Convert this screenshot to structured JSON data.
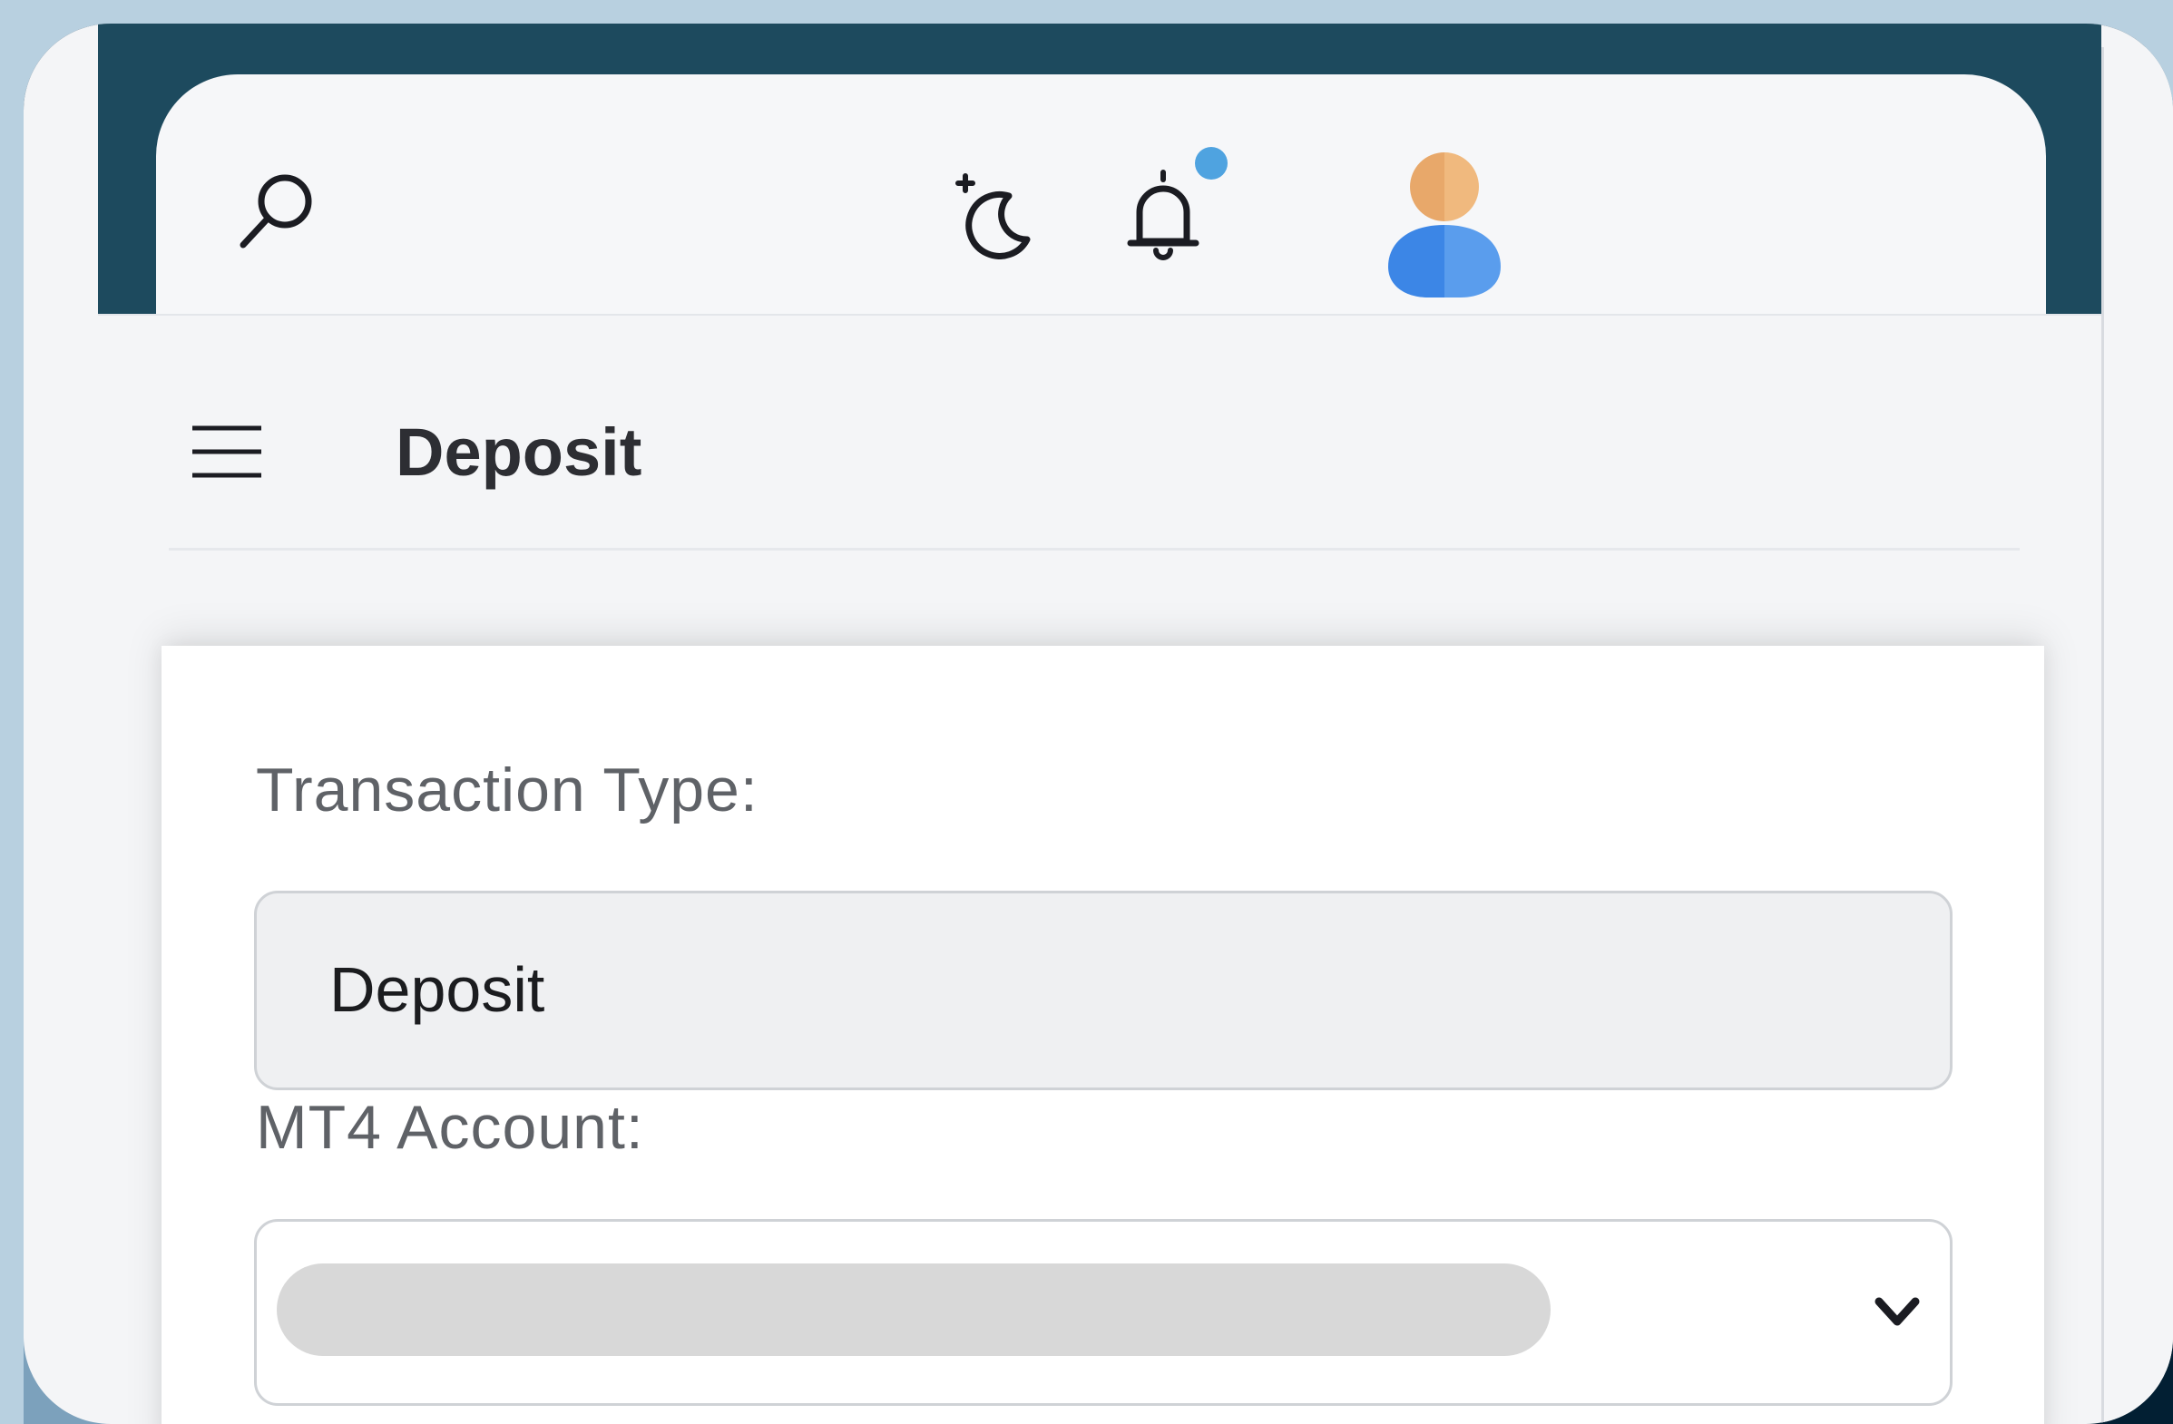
{
  "header": {
    "icons": [
      "search-icon",
      "moon-icon",
      "bell-icon",
      "avatar"
    ],
    "notification_dot_color": "#4fa3e0"
  },
  "subheader": {
    "title": "Deposit"
  },
  "form": {
    "transaction_type_label": "Transaction Type:",
    "transaction_type_value": "Deposit",
    "account_label": "MT4 Account:",
    "account_value": ""
  },
  "colors": {
    "header_band": "#1d4a5e",
    "frame": "#021f33",
    "background": "#b8d0e0"
  }
}
